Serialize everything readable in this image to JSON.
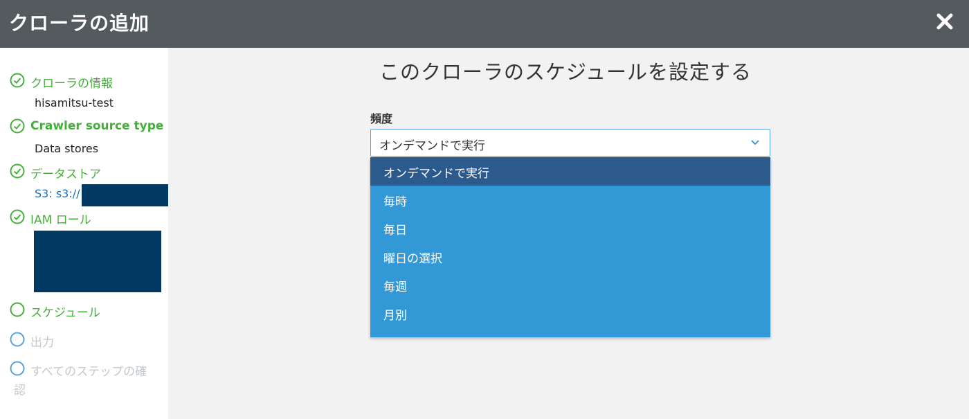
{
  "window": {
    "title": "クローラの追加",
    "close_icon": "close-icon"
  },
  "sidebar": {
    "steps": [
      {
        "label": "クローラの情報",
        "status": "done",
        "sub": "hisamitsu-test"
      },
      {
        "label": "Crawler source type",
        "status": "done",
        "sub": "Data stores"
      },
      {
        "label": "データストア",
        "status": "done",
        "sub": "S3: s3://"
      },
      {
        "label": "IAM ロール",
        "status": "done"
      },
      {
        "label": "スケジュール",
        "status": "current"
      },
      {
        "label": "出力",
        "status": "future"
      },
      {
        "label": "すべてのステップの確",
        "label_cont": "認",
        "status": "future"
      }
    ]
  },
  "main": {
    "heading": "このクローラのスケジュールを設定する",
    "frequency": {
      "label": "頻度",
      "selected": "オンデマンドで実行",
      "options": [
        "オンデマンドで実行",
        "毎時",
        "毎日",
        "曜日の選択",
        "毎週",
        "月別"
      ]
    }
  },
  "colors": {
    "titlebar": "#545b5e",
    "done_green": "#44b03a",
    "future_gray": "#c3c8cc",
    "dropdown_bg": "#3399d6",
    "dropdown_selected": "#2c5a8c",
    "redaction": "#003a63"
  }
}
